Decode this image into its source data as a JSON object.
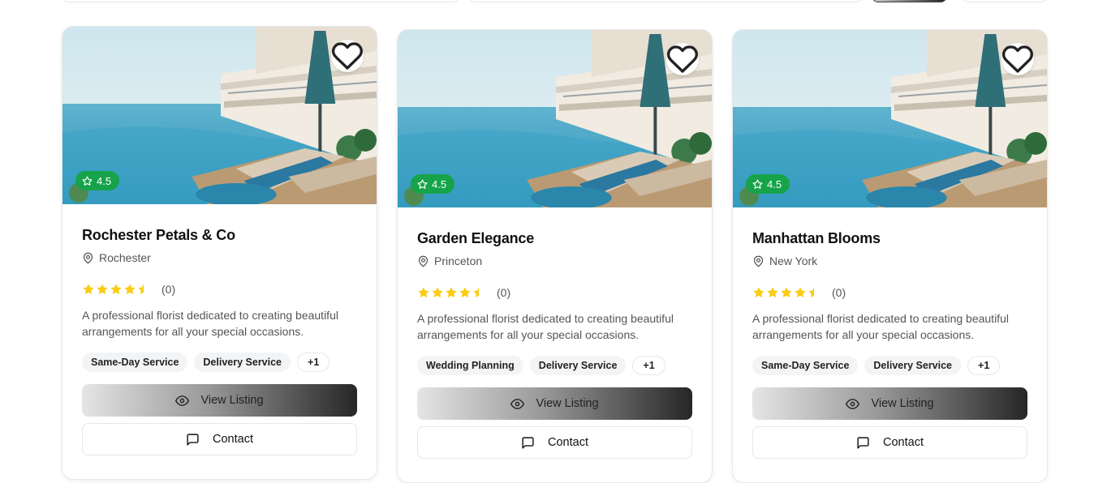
{
  "colors": {
    "rating_badge": "#16a34a",
    "star": "#facc15",
    "border": "#e5e7eb"
  },
  "icons": {
    "favorite": "heart-icon",
    "rating": "star-icon",
    "location": "map-pin-icon",
    "view": "eye-icon",
    "contact": "message-square-icon"
  },
  "listings": [
    {
      "badge_rating": "4.5",
      "title": "Rochester Petals & Co",
      "location": "Rochester",
      "stars": 4.5,
      "review_count": "(0)",
      "description": "A professional florist dedicated to creating beautiful arrangements for all your special occasions.",
      "tags": [
        "Same-Day Service",
        "Delivery Service"
      ],
      "more_tags": "+1",
      "view_label": "View Listing",
      "contact_label": "Contact"
    },
    {
      "badge_rating": "4.5",
      "title": "Garden Elegance",
      "location": "Princeton",
      "stars": 4.5,
      "review_count": "(0)",
      "description": "A professional florist dedicated to creating beautiful arrangements for all your special occasions.",
      "tags": [
        "Wedding Planning",
        "Delivery Service"
      ],
      "more_tags": "+1",
      "view_label": "View Listing",
      "contact_label": "Contact"
    },
    {
      "badge_rating": "4.5",
      "title": "Manhattan Blooms",
      "location": "New York",
      "stars": 4.5,
      "review_count": "(0)",
      "description": "A professional florist dedicated to creating beautiful arrangements for all your special occasions.",
      "tags": [
        "Same-Day Service",
        "Delivery Service"
      ],
      "more_tags": "+1",
      "view_label": "View Listing",
      "contact_label": "Contact"
    }
  ]
}
